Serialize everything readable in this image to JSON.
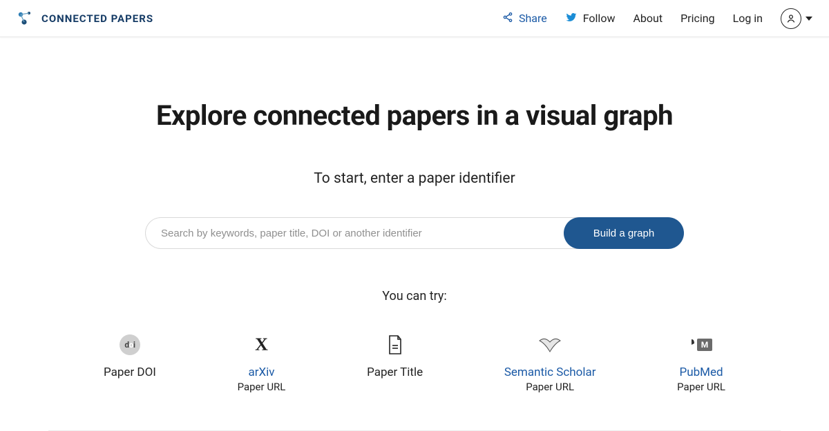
{
  "header": {
    "brand": "CONNECTED PAPERS",
    "share_label": "Share",
    "follow_label": "Follow",
    "about_label": "About",
    "pricing_label": "Pricing",
    "login_label": "Log in"
  },
  "hero": {
    "title": "Explore connected papers in a visual graph",
    "subtitle": "To start, enter a paper identifier"
  },
  "search": {
    "placeholder": "Search by keywords, paper title, DOI or another identifier",
    "button_label": "Build a graph"
  },
  "try": {
    "label": "You can try:",
    "items": [
      {
        "title": "Paper DOI",
        "sub": "",
        "link": false
      },
      {
        "title": "arXiv",
        "sub": "Paper URL",
        "link": true
      },
      {
        "title": "Paper Title",
        "sub": "",
        "link": false
      },
      {
        "title": "Semantic Scholar",
        "sub": "Paper URL",
        "link": true
      },
      {
        "title": "PubMed",
        "sub": "Paper URL",
        "link": true
      }
    ]
  }
}
